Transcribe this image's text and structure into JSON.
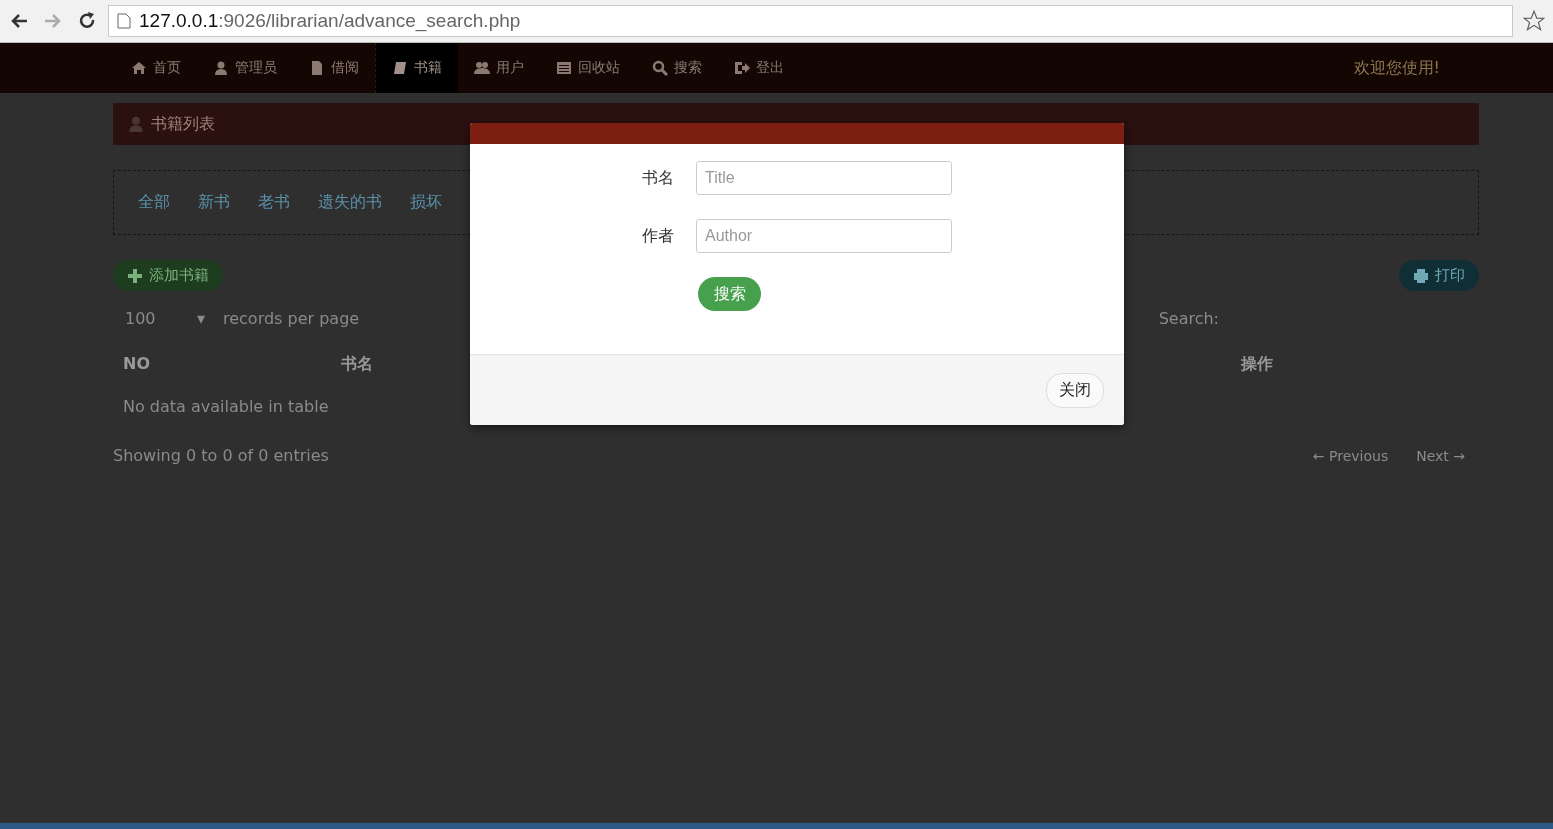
{
  "browser": {
    "url": {
      "host": "127.0.0.1",
      "path": ":9026/librarian/advance_search.php"
    }
  },
  "nav": {
    "items": [
      {
        "label": "首页",
        "selected": false
      },
      {
        "label": "管理员",
        "selected": false
      },
      {
        "label": "借阅",
        "selected": false
      },
      {
        "label": "书籍",
        "selected": true
      },
      {
        "label": "用户",
        "selected": false
      },
      {
        "label": "回收站",
        "selected": false
      },
      {
        "label": "搜索",
        "selected": false
      },
      {
        "label": "登出",
        "selected": false
      }
    ],
    "welcome": "欢迎您使用!"
  },
  "panel": {
    "title": "书籍列表"
  },
  "filters": [
    "全部",
    "新书",
    "老书",
    "遗失的书",
    "损坏"
  ],
  "add_button": "添加书籍",
  "print_button": "打印",
  "length": {
    "value": "100",
    "caret": "▾",
    "label": "records per page"
  },
  "search_label": "Search:",
  "table": {
    "columns": [
      "NO",
      "书名",
      "操作"
    ],
    "empty": "No data available in table"
  },
  "info": "Showing 0 to 0 of 0 entries",
  "pagination": {
    "previous": "← Previous",
    "next": "Next →"
  },
  "modal": {
    "fields": [
      {
        "label": "书名",
        "placeholder": "Title"
      },
      {
        "label": "作者",
        "placeholder": "Author"
      }
    ],
    "search_button": "搜索",
    "close_button": "关闭"
  }
}
